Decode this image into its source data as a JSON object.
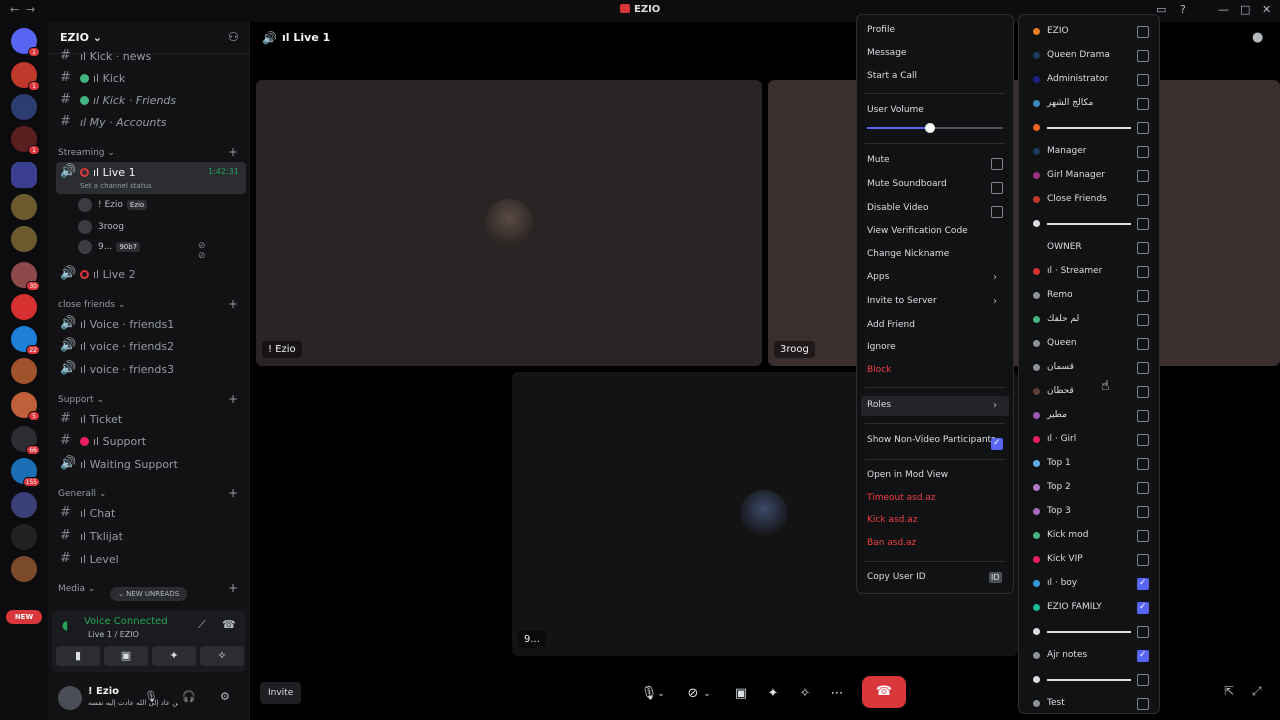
{
  "window": {
    "title": "EZIO"
  },
  "rail": {
    "new_label": "NEW",
    "badges": [
      "1",
      "1",
      "1",
      "30",
      "22",
      "5",
      "66",
      "155"
    ]
  },
  "guild": {
    "name": "EZIO"
  },
  "channels": [
    {
      "label": "ıl Kick · news"
    },
    {
      "label": "ıl Kick"
    },
    {
      "label": "ıl Kick · Friends"
    },
    {
      "label": "ıl My · Accounts"
    }
  ],
  "cat_streaming": "Streaming",
  "live1": {
    "label": "ıl Live 1",
    "time": "1:42:31",
    "status": "Set a channel status"
  },
  "voice_users": [
    {
      "name": "! Ezio",
      "tag": "Ezio"
    },
    {
      "name": "3roog",
      "tag": ""
    },
    {
      "name": "9...",
      "tag": "90b7"
    }
  ],
  "live2": {
    "label": "ıl Live 2"
  },
  "cat_close": "close friends",
  "close_channels": [
    {
      "label": "ıl Voice · friends1"
    },
    {
      "label": "ıl voice · friends2"
    },
    {
      "label": "ıl voice · friends3"
    }
  ],
  "cat_support": "Support",
  "support_channels": [
    {
      "label": "ıl Ticket"
    },
    {
      "label": "ıl Support"
    },
    {
      "label": "ıl Waiting Support"
    }
  ],
  "cat_general": "Generall",
  "general_channels": [
    {
      "label": "ıl Chat"
    },
    {
      "label": "ıl Tklijat"
    },
    {
      "label": "ıl Level"
    }
  ],
  "cat_media": "Media",
  "new_unreads": "NEW UNREADS",
  "voice_panel": {
    "status": "Voice Connected",
    "sub": "Live 1 / EZIO"
  },
  "user": {
    "name": "! Ezio",
    "sub": "من عاد إلى الله عادت إليه نفسه"
  },
  "call": {
    "channel": "ıl Live 1",
    "tiles": [
      {
        "label": "! Ezio"
      },
      {
        "label": "3roog"
      },
      {
        "label": "9..."
      }
    ],
    "invite": "Invite"
  },
  "menu": {
    "profile": "Profile",
    "message": "Message",
    "start_call": "Start a Call",
    "user_volume": "User Volume",
    "volume_level": 0.46,
    "mute": "Mute",
    "mute_soundboard": "Mute Soundboard",
    "disable_video": "Disable Video",
    "view_verification": "View Verification Code",
    "change_nickname": "Change Nickname",
    "apps": "Apps",
    "invite_server": "Invite to Server",
    "add_friend": "Add Friend",
    "ignore": "Ignore",
    "block": "Block",
    "roles": "Roles",
    "show_nonvideo": "Show Non-Video Participants",
    "mod_view": "Open in Mod View",
    "timeout": "Timeout asd.az",
    "kick": "Kick asd.az",
    "ban": "Ban asd.az",
    "copy_id": "Copy User ID"
  },
  "roles": [
    {
      "name": "EZIO",
      "color": "#e67e22",
      "checked": false
    },
    {
      "name": "Queen Drama",
      "color": "#1e3a5f",
      "checked": false
    },
    {
      "name": "Administrator",
      "color": "#1a237e",
      "checked": false
    },
    {
      "name": "مكالج الشهر",
      "color": "#3a8bbd",
      "checked": false
    },
    {
      "name": "",
      "color": "#f26522",
      "checked": false,
      "slider": true
    },
    {
      "name": "Manager",
      "color": "#1e3a5f",
      "checked": false
    },
    {
      "name": "Girl Manager",
      "color": "#9b2d7f",
      "checked": false
    },
    {
      "name": "Close Friends",
      "color": "#c0392b",
      "checked": false
    },
    {
      "name": "",
      "color": "#dbdee1",
      "checked": false,
      "slider": true
    },
    {
      "name": "OWNER",
      "color": "#111111",
      "checked": false
    },
    {
      "name": "ıl · Streamer",
      "color": "#d63031",
      "checked": false
    },
    {
      "name": "Remo",
      "color": "#8e9297",
      "checked": false
    },
    {
      "name": "لم حلفك",
      "color": "#43b581",
      "checked": false
    },
    {
      "name": "Queen",
      "color": "#8e9297",
      "checked": false
    },
    {
      "name": "قسمان",
      "color": "#8e9297",
      "checked": false
    },
    {
      "name": "قحطان",
      "color": "#5c4033",
      "checked": false
    },
    {
      "name": "مطير",
      "color": "#9b59b6",
      "checked": false
    },
    {
      "name": "ıl · Girl",
      "color": "#e91e63",
      "checked": false
    },
    {
      "name": "Top 1",
      "color": "#5dade2",
      "checked": false
    },
    {
      "name": "Top 2",
      "color": "#af7ac5",
      "checked": false
    },
    {
      "name": "Top 3",
      "color": "#a569bd",
      "checked": false
    },
    {
      "name": "Kick mod",
      "color": "#43b581",
      "checked": false
    },
    {
      "name": "Kick VIP",
      "color": "#e91e63",
      "checked": false
    },
    {
      "name": "ıl · boy",
      "color": "#3498db",
      "checked": true
    },
    {
      "name": "EZIO FAMILY",
      "color": "#1abc9c",
      "checked": true
    },
    {
      "name": "",
      "color": "#dbdee1",
      "checked": false,
      "slider": true
    },
    {
      "name": "Ajr notes",
      "color": "#8e9297",
      "checked": true
    },
    {
      "name": "",
      "color": "#dbdee1",
      "checked": false,
      "slider": true
    },
    {
      "name": "Test",
      "color": "#8e9297",
      "checked": false
    }
  ]
}
